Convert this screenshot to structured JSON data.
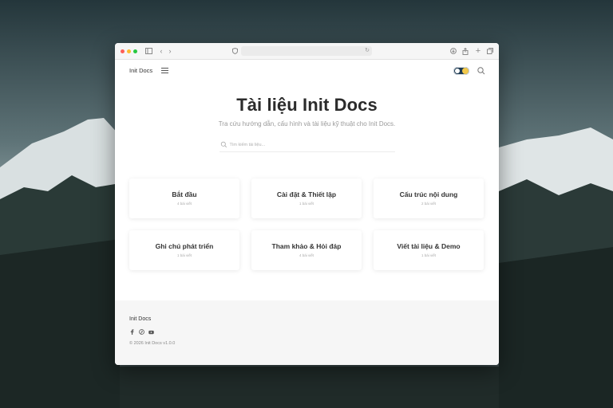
{
  "header": {
    "brand": "Init Docs"
  },
  "hero": {
    "title": "Tài liệu Init Docs",
    "subtitle": "Tra cứu hướng dẫn, cấu hình và tài liệu kỹ thuật cho Init Docs."
  },
  "search": {
    "placeholder": "Tìm kiếm tài liệu..."
  },
  "categories": [
    {
      "title": "Bắt đầu",
      "count": "4 bài viết"
    },
    {
      "title": "Cài đặt & Thiết lập",
      "count": "1 bài viết"
    },
    {
      "title": "Cấu trúc nội dung",
      "count": "2 bài viết"
    },
    {
      "title": "Ghi chú phát triển",
      "count": "1 bài viết"
    },
    {
      "title": "Tham khảo & Hỏi đáp",
      "count": "4 bài viết"
    },
    {
      "title": "Viết tài liệu & Demo",
      "count": "1 bài viết"
    }
  ],
  "footer": {
    "brand": "Init Docs",
    "social_icons": [
      "facebook-icon",
      "pinterest-icon",
      "youtube-icon"
    ],
    "copyright": "© 2026 Init Docs v1.0.0"
  },
  "colors": {
    "traffic_red": "#fe5f57",
    "traffic_yellow": "#febc2e",
    "traffic_green": "#28c840",
    "toggle_track": "#1e3a52",
    "toggle_sun": "#f2c94c"
  }
}
